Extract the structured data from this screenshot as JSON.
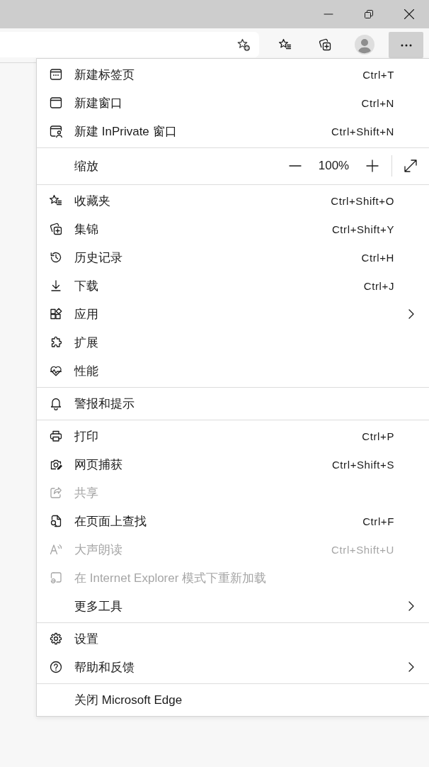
{
  "toolbar": {
    "more_button": {
      "pressed": true
    }
  },
  "menu": {
    "sections": [
      {
        "items": [
          {
            "kind": "item",
            "label": "新建标签页",
            "shortcut": "Ctrl+T",
            "disabled": false,
            "submenu": false
          },
          {
            "kind": "item",
            "label": "新建窗口",
            "shortcut": "Ctrl+N",
            "disabled": false,
            "submenu": false
          },
          {
            "kind": "item",
            "label": "新建 InPrivate 窗口",
            "shortcut": "Ctrl+Shift+N",
            "disabled": false,
            "submenu": false
          }
        ]
      },
      {
        "items": [
          {
            "kind": "zoom",
            "label": "缩放",
            "value": "100%"
          }
        ]
      },
      {
        "items": [
          {
            "kind": "item",
            "label": "收藏夹",
            "shortcut": "Ctrl+Shift+O",
            "disabled": false,
            "submenu": false
          },
          {
            "kind": "item",
            "label": "集锦",
            "shortcut": "Ctrl+Shift+Y",
            "disabled": false,
            "submenu": false
          },
          {
            "kind": "item",
            "label": "历史记录",
            "shortcut": "Ctrl+H",
            "disabled": false,
            "submenu": false
          },
          {
            "kind": "item",
            "label": "下载",
            "shortcut": "Ctrl+J",
            "disabled": false,
            "submenu": false
          },
          {
            "kind": "item",
            "label": "应用",
            "disabled": false,
            "submenu": true
          },
          {
            "kind": "item",
            "label": "扩展",
            "disabled": false,
            "submenu": false
          },
          {
            "kind": "item",
            "label": "性能",
            "disabled": false,
            "submenu": false
          }
        ]
      },
      {
        "items": [
          {
            "kind": "item",
            "label": "警报和提示",
            "disabled": false,
            "submenu": false
          }
        ]
      },
      {
        "items": [
          {
            "kind": "item",
            "label": "打印",
            "shortcut": "Ctrl+P",
            "disabled": false,
            "submenu": false
          },
          {
            "kind": "item",
            "label": "网页捕获",
            "shortcut": "Ctrl+Shift+S",
            "disabled": false,
            "submenu": false
          },
          {
            "kind": "item",
            "label": "共享",
            "disabled": true,
            "submenu": false
          },
          {
            "kind": "item",
            "label": "在页面上查找",
            "shortcut": "Ctrl+F",
            "disabled": false,
            "submenu": false
          },
          {
            "kind": "item",
            "label": "大声朗读",
            "shortcut": "Ctrl+Shift+U",
            "disabled": true,
            "submenu": false
          },
          {
            "kind": "item",
            "label": "在 Internet Explorer 模式下重新加载",
            "disabled": true,
            "submenu": false
          },
          {
            "kind": "item",
            "label": "更多工具",
            "disabled": false,
            "submenu": true
          }
        ]
      },
      {
        "items": [
          {
            "kind": "item",
            "label": "设置",
            "disabled": false,
            "submenu": false
          },
          {
            "kind": "item",
            "label": "帮助和反馈",
            "disabled": false,
            "submenu": true
          }
        ]
      },
      {
        "items": [
          {
            "kind": "item",
            "label": "关闭 Microsoft Edge",
            "disabled": false,
            "submenu": false
          }
        ]
      }
    ]
  }
}
